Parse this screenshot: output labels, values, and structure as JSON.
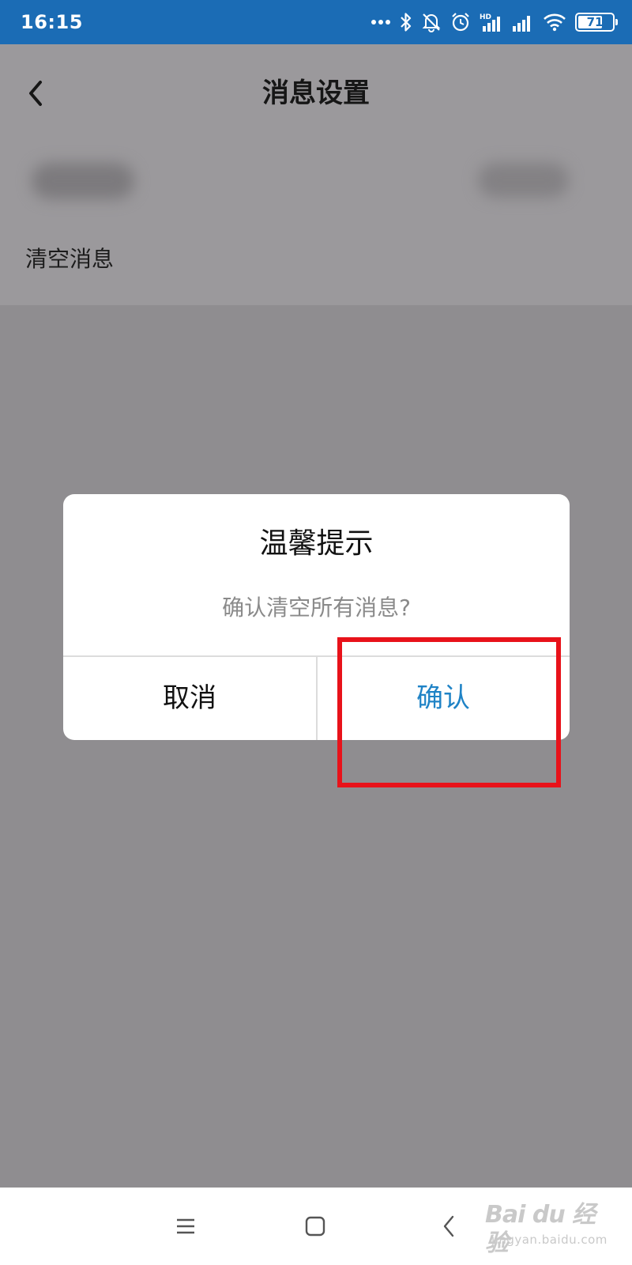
{
  "status_bar": {
    "time": "16:15",
    "icons": [
      "more-dots-icon",
      "bluetooth-icon",
      "mute-bell-icon",
      "alarm-icon",
      "hd-signal-icon",
      "signal-icon",
      "wifi-icon"
    ],
    "battery_level": "71",
    "battery_fraction": 0.71
  },
  "header": {
    "title": "消息设置",
    "back_icon": "chevron-left-icon"
  },
  "settings": {
    "clear_messages_label": "清空消息"
  },
  "dialog": {
    "title": "温馨提示",
    "message": "确认清空所有消息?",
    "cancel_label": "取消",
    "confirm_label": "确认",
    "confirm_color": "#1f83c6"
  },
  "annotation": {
    "highlight_color": "#e8121a"
  },
  "nav_bar": {
    "icons": [
      "menu-icon",
      "home-icon",
      "back-icon"
    ]
  },
  "watermark": {
    "main": "Bai du 经验",
    "sub": "jingyan.baidu.com"
  },
  "colors": {
    "status_bar": "#1b6cb5",
    "overlay": "#8f8d90"
  }
}
